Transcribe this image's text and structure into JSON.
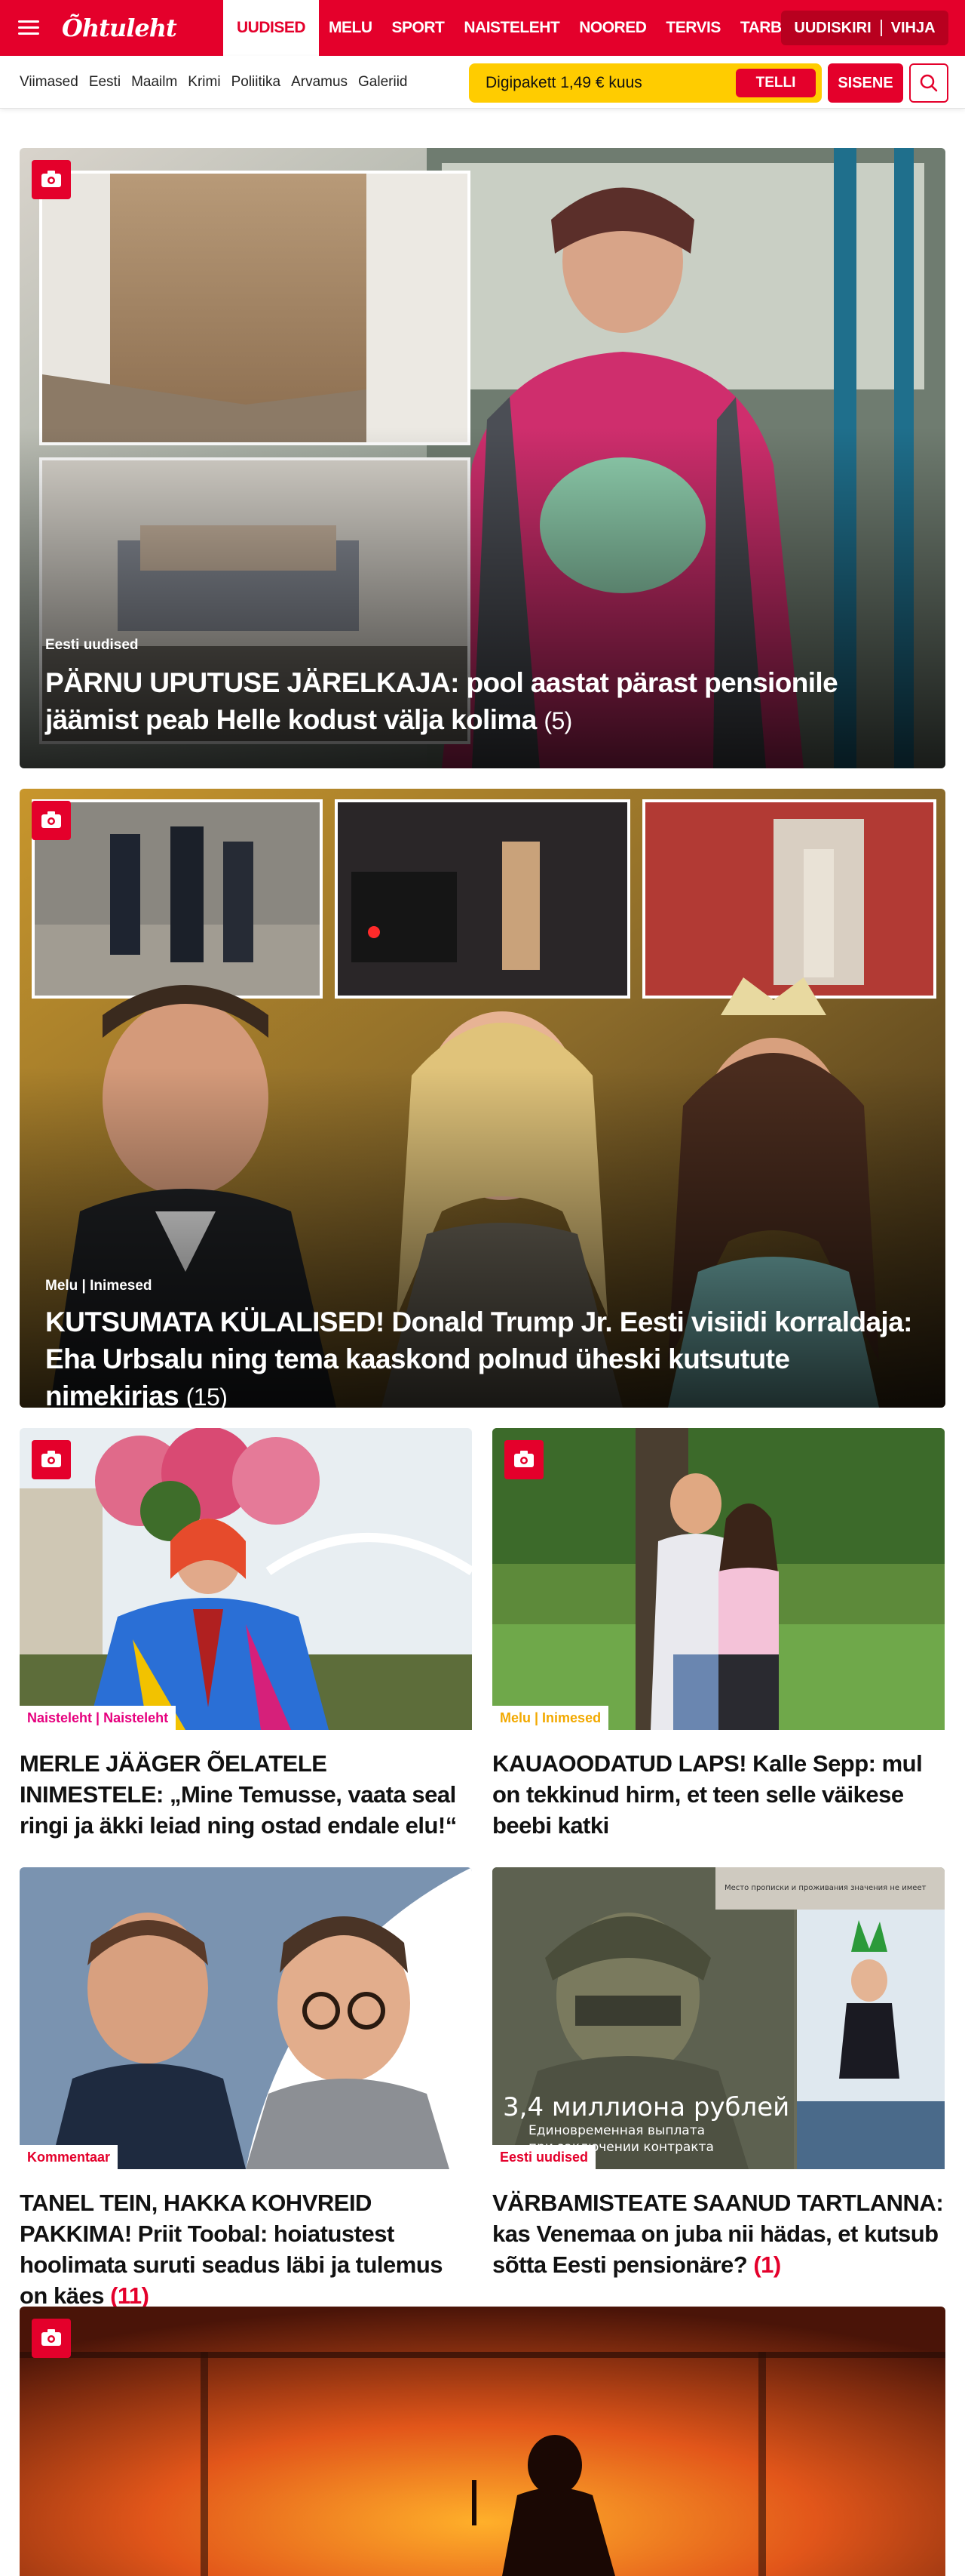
{
  "header": {
    "logo_text": "Õhtuleht",
    "nav": [
      "UUDISED",
      "MELU",
      "SPORT",
      "NAISTELEHT",
      "NOORED",
      "TERVIS",
      "TARBIJA"
    ],
    "newsletter_label": "UUDISKIRI",
    "tip_label": "VIHJA",
    "brand_color": "#e4002b"
  },
  "subnav": {
    "items": [
      "Viimased",
      "Eesti",
      "Maailm",
      "Krimi",
      "Poliitika",
      "Arvamus",
      "Galeriid"
    ],
    "promo_text": "Digipakett 1,49 € kuus",
    "promo_button": "TELLI",
    "login_button": "SISENE",
    "search_icon": "search-icon",
    "promo_color": "#ffcc00"
  },
  "articles": {
    "hero1": {
      "category": "Eesti uudised",
      "title": "PÄRNU UPUTUSE JÄRELKAJA: pool aastat pärast pensionile jäämist peab Helle kodust välja kolima",
      "count": "(5)"
    },
    "hero2": {
      "category": "Melu | Inimesed",
      "title": "KUTSUMATA KÜLALISED! Donald Trump Jr. Eesti visiidi korraldaja: Eha Urbsalu ning tema kaaskond polnud üheski kutsutute nimekirjas",
      "count": "(15)"
    },
    "tiles": [
      {
        "category": "Naisteleht | Naisteleht",
        "category_color": "#e6007e",
        "title": "MERLE JÄÄGER ÕELATELE INIMESTELE: „Mine Temusse, vaata seal ringi ja äkki leiad ning ostad endale elu!“",
        "count": ""
      },
      {
        "category": "Melu | Inimesed",
        "category_color": "#f2a900",
        "title": "KAUAOODATUD LAPS! Kalle Sepp: mul on tekkinud hirm, et teen selle väikese beebi katki",
        "count": ""
      },
      {
        "category": "Kommentaar",
        "category_color": "#e4002b",
        "title": "TANEL TEIN, HAKKA KOHVREID PAKKIMA! Priit Toobal: hoiatustest hoolimata suruti seadus läbi ja tulemus on käes",
        "count": "(11)"
      },
      {
        "category": "Eesti uudised",
        "category_color": "#e4002b",
        "title": "VÄRBAMISTEATE SAANUD TARTLANNA: kas Venemaa on juba nii hädas, et kutsub sõtta Eesti pensionäre?",
        "count": "(1)"
      }
    ],
    "recruit_overlay": {
      "top_strip": "Место прописки и проживания значения не имеет",
      "big": "3,4 миллиона рублей",
      "line1": "Единовременная выплата",
      "line2": "при заключении контракта"
    }
  }
}
